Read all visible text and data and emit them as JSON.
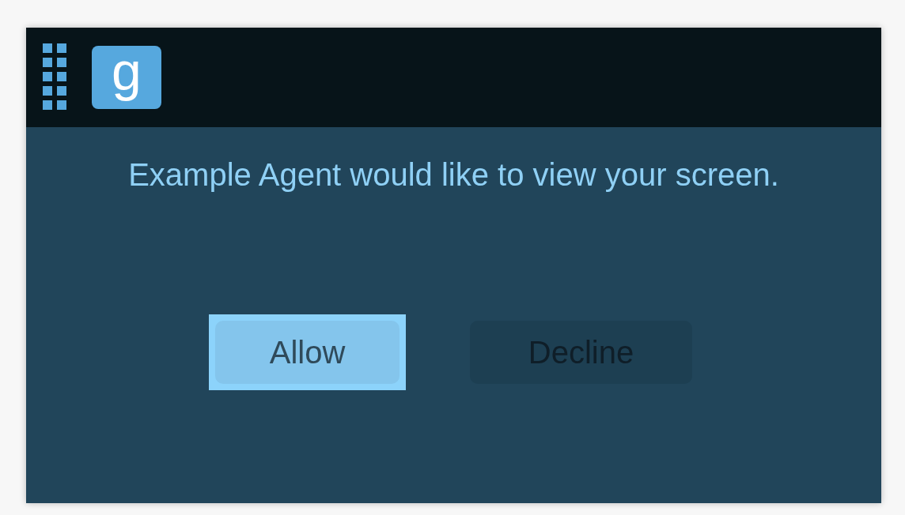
{
  "header": {
    "logo": "g"
  },
  "message": "Example Agent would like to view your screen.",
  "buttons": [
    {
      "label": "Allow",
      "kind": "primary",
      "focused": true
    },
    {
      "label": "Decline",
      "kind": "secondary",
      "focused": false
    }
  ]
}
